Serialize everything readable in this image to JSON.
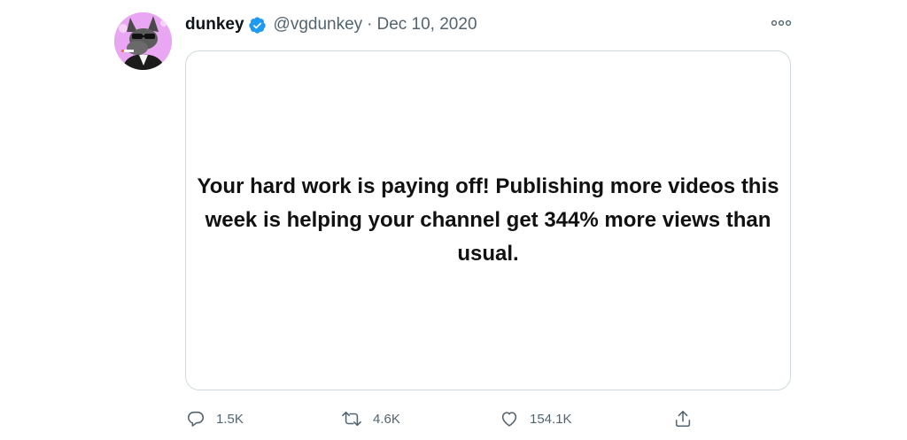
{
  "tweet": {
    "display_name": "dunkey",
    "handle": "@vgdunkey",
    "separator": "·",
    "date": "Dec 10, 2020",
    "body": "Your hard work is paying off! Publishing more videos this week is helping your channel get 344% more views than usual."
  },
  "actions": {
    "replies": "1.5K",
    "retweets": "4.6K",
    "likes": "154.1K"
  },
  "icons": {
    "verified": "verified-badge-icon",
    "more": "more-options-icon",
    "reply": "reply-icon",
    "retweet": "retweet-icon",
    "like": "heart-icon",
    "share": "share-icon"
  },
  "colors": {
    "verified": "#1d9bf0",
    "secondary_text": "#536471",
    "card_border": "#cfd9de",
    "avatar_bg": "#e9a6f2"
  }
}
